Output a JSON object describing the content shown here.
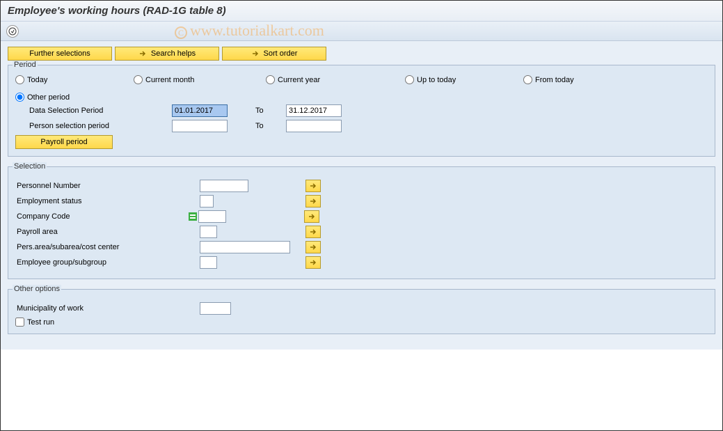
{
  "header": {
    "title": "Employee's working hours (RAD-1G table 8)"
  },
  "toolbar": {
    "further_selections": "Further selections",
    "search_helps": "Search helps",
    "sort_order": "Sort order"
  },
  "period": {
    "box_title": "Period",
    "radios": {
      "today": "Today",
      "current_month": "Current month",
      "current_year": "Current year",
      "up_to_today": "Up to today",
      "from_today": "From today",
      "other_period": "Other period"
    },
    "selected": "other_period",
    "data_selection_label": "Data Selection Period",
    "data_selection_from": "01.01.2017",
    "to_label": "To",
    "data_selection_to": "31.12.2017",
    "person_selection_label": "Person selection period",
    "person_selection_from": "",
    "person_selection_to": "",
    "payroll_period_btn": "Payroll period"
  },
  "selection": {
    "box_title": "Selection",
    "personnel_number_label": "Personnel Number",
    "personnel_number_value": "",
    "employment_status_label": "Employment status",
    "employment_status_value": "",
    "company_code_label": "Company Code",
    "company_code_value": "",
    "payroll_area_label": "Payroll area",
    "payroll_area_value": "",
    "pers_area_label": "Pers.area/subarea/cost center",
    "pers_area_value": "",
    "employee_group_label": "Employee group/subgroup",
    "employee_group_value": ""
  },
  "other": {
    "box_title": "Other options",
    "municipality_label": "Municipality of work",
    "municipality_value": "",
    "test_run_label": "Test run",
    "test_run_checked": false
  },
  "watermark": "www.tutorialkart.com"
}
